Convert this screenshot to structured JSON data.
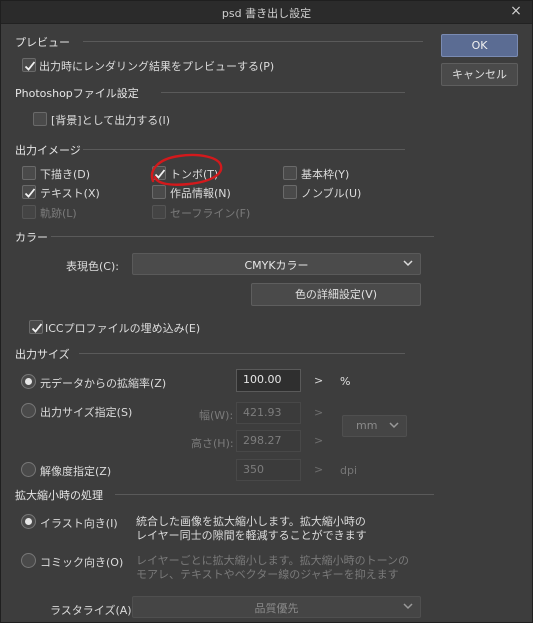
{
  "window": {
    "title": "psd 書き出し設定",
    "close": "×"
  },
  "buttons": {
    "ok": "OK",
    "cancel": "キャンセル"
  },
  "preview": {
    "title": "プレビュー",
    "render_preview_label": "出力時にレンダリング結果をプレビューする(P)",
    "render_preview_checked": true
  },
  "photoshop": {
    "title": "Photoshopファイル設定",
    "background_label": "[背景]として出力する(I)",
    "background_checked": false
  },
  "output_image": {
    "title": "出力イメージ",
    "items": [
      {
        "label": "下描き(D)",
        "checked": false,
        "enabled": true
      },
      {
        "label": "トンボ(T)",
        "checked": true,
        "enabled": true
      },
      {
        "label": "基本枠(Y)",
        "checked": false,
        "enabled": true
      },
      {
        "label": "テキスト(X)",
        "checked": true,
        "enabled": true
      },
      {
        "label": "作品情報(N)",
        "checked": false,
        "enabled": true
      },
      {
        "label": "ノンブル(U)",
        "checked": false,
        "enabled": true
      },
      {
        "label": "軌跡(L)",
        "checked": false,
        "enabled": false
      },
      {
        "label": "セーフライン(F)",
        "checked": false,
        "enabled": false
      }
    ]
  },
  "color": {
    "title": "カラー",
    "expression_label": "表現色(C):",
    "expression_value": "CMYKカラー",
    "detail_button": "色の詳細設定(V)",
    "icc_label": "ICCプロファイルの埋め込み(E)",
    "icc_checked": true
  },
  "output_size": {
    "title": "出力サイズ",
    "scale_label": "元データからの拡縮率(Z)",
    "scale_value": "100.00",
    "scale_unit": "%",
    "size_label": "出力サイズ指定(S)",
    "width_label": "幅(W):",
    "width_value": "421.93",
    "height_label": "高さ(H):",
    "height_value": "298.27",
    "size_unit": "mm",
    "resolution_label": "解像度指定(Z)",
    "resolution_value": "350",
    "resolution_unit": "dpi",
    "selected": "scale"
  },
  "scaling": {
    "title": "拡大縮小時の処理",
    "illust_label": "イラスト向き(I)",
    "illust_desc_1": "統合した画像を拡大縮小します。拡大縮小時の",
    "illust_desc_2": "レイヤー同士の隙間を軽減することができます",
    "comic_label": "コミック向き(O)",
    "comic_desc_1": "レイヤーごとに拡大縮小します。拡大縮小時のトーンの",
    "comic_desc_2": "モアレ、テキストやベクター線のジャギーを抑えます",
    "selected": "illust",
    "rasterize_label": "ラスタライズ(A):",
    "rasterize_value": "品質優先"
  },
  "annotation": {
    "color": "#d3191c"
  },
  "colors": {
    "accent": "#5b6c93",
    "dialog_bg": "#3d3d3d"
  }
}
